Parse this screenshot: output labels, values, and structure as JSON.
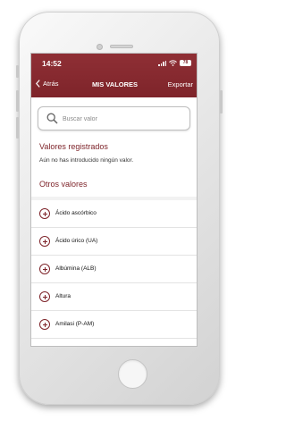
{
  "status_bar": {
    "time": "14:52",
    "battery": "78",
    "icons": [
      "signal-icon",
      "wifi-icon",
      "battery-icon"
    ]
  },
  "nav": {
    "back_label": "Atrás",
    "title": "MIS VALORES",
    "export_label": "Exportar"
  },
  "search": {
    "placeholder": "Buscar valor",
    "value": ""
  },
  "registered": {
    "title": "Valores registrados",
    "empty_message": "Aún no has introducido ningún valor."
  },
  "others": {
    "title": "Otros valores",
    "items": [
      {
        "label": "Ácido ascórbico"
      },
      {
        "label": "Ácido úrico (UA)"
      },
      {
        "label": "Albúmina (ALB)"
      },
      {
        "label": "Altura"
      },
      {
        "label": "Amilasi (P-AM)"
      }
    ]
  },
  "colors": {
    "brand": "#7e242a",
    "header_top": "#8f2f35",
    "background": "#ffffff",
    "divider": "#e3e3e3"
  }
}
